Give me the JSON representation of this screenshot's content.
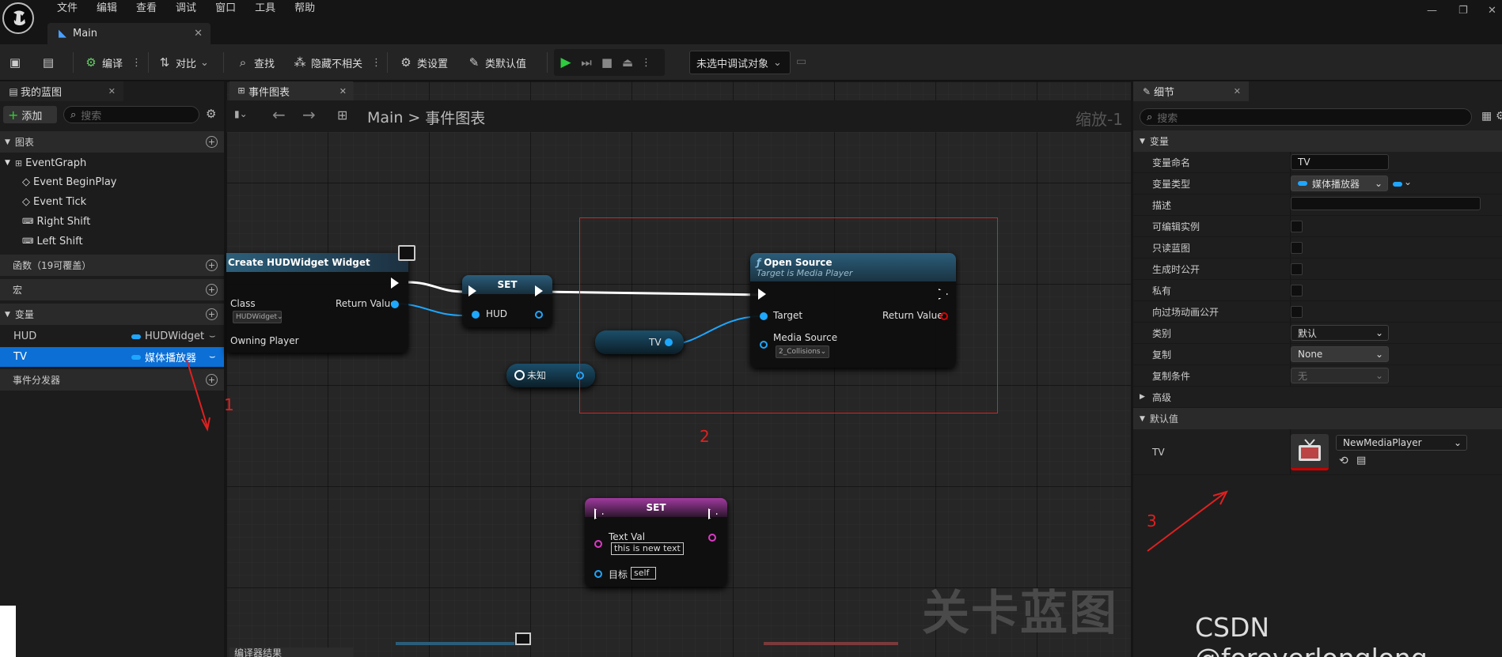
{
  "menu": [
    "文件",
    "编辑",
    "查看",
    "调试",
    "窗口",
    "工具",
    "帮助"
  ],
  "doc_tab": {
    "label": "Main"
  },
  "toolbar": {
    "compile": "编译",
    "diff": "对比",
    "find": "查找",
    "hide_unrelated": "隐藏不相关",
    "class_settings": "类设置",
    "class_defaults": "类默认值",
    "debug_select": "未选中调试对象"
  },
  "left": {
    "tab": "我的蓝图",
    "add": "添加",
    "search_placeholder": "搜索",
    "graphs_header": "图表",
    "graph_items": [
      "EventGraph",
      "Event BeginPlay",
      "Event Tick",
      "Right Shift",
      "Left Shift"
    ],
    "functions_header": "函数（19可覆盖）",
    "macros_header": "宏",
    "variables_header": "变量",
    "variables": [
      {
        "name": "HUD",
        "type": "HUDWidget"
      },
      {
        "name": "TV",
        "type": "媒体播放器"
      }
    ],
    "dispatchers_header": "事件分发器"
  },
  "graph": {
    "tab": "事件图表",
    "crumb_root": "Main",
    "crumb_sep": ">",
    "crumb_leaf": "事件图表",
    "zoom": "缩放-1",
    "watermark": "关卡蓝图",
    "bottom_tab": "编译器结果",
    "create_node": {
      "title": "Create HUDWidget Widget",
      "class_label": "Class",
      "class_value": "HUDWidget",
      "return_label": "Return Value",
      "owner_label": "Owning Player"
    },
    "set_hud": {
      "title": "SET",
      "pin": "HUD"
    },
    "open_source": {
      "title": "Open Source",
      "subtitle": "Target is Media Player",
      "target": "Target",
      "return": "Return Value",
      "media": "Media Source",
      "media_value": "2_Collisions"
    },
    "tv_var": {
      "label": "TV"
    },
    "unknown": {
      "label": "未知"
    },
    "set_text": {
      "title": "SET",
      "pin1": "Text Val",
      "value1": "this is new text",
      "pin2": "目标",
      "value2": "self"
    }
  },
  "details": {
    "tab": "细节",
    "search_placeholder": "搜索",
    "var_section": "变量",
    "rows": [
      {
        "label": "变量命名",
        "value": "TV"
      },
      {
        "label": "变量类型",
        "value": "媒体播放器"
      },
      {
        "label": "描述",
        "value": ""
      },
      {
        "label": "可编辑实例"
      },
      {
        "label": "只读蓝图"
      },
      {
        "label": "生成时公开"
      },
      {
        "label": "私有"
      },
      {
        "label": "向过场动画公开"
      },
      {
        "label": "类别",
        "value": "默认"
      },
      {
        "label": "复制",
        "value": "None"
      },
      {
        "label": "复制条件",
        "value": "无"
      }
    ],
    "advanced": "高级",
    "defaults_section": "默认值",
    "default_label": "TV",
    "default_value": "NewMediaPlayer"
  },
  "annotations": {
    "n1": "1",
    "n2": "2",
    "n3": "3",
    "accent": "#e02020"
  },
  "watermark_site": "CSDN @foreverlonglong",
  "colors": {
    "accent": "#1ea7ff",
    "selection": "#0b6fd6",
    "play": "#2ecc40"
  }
}
